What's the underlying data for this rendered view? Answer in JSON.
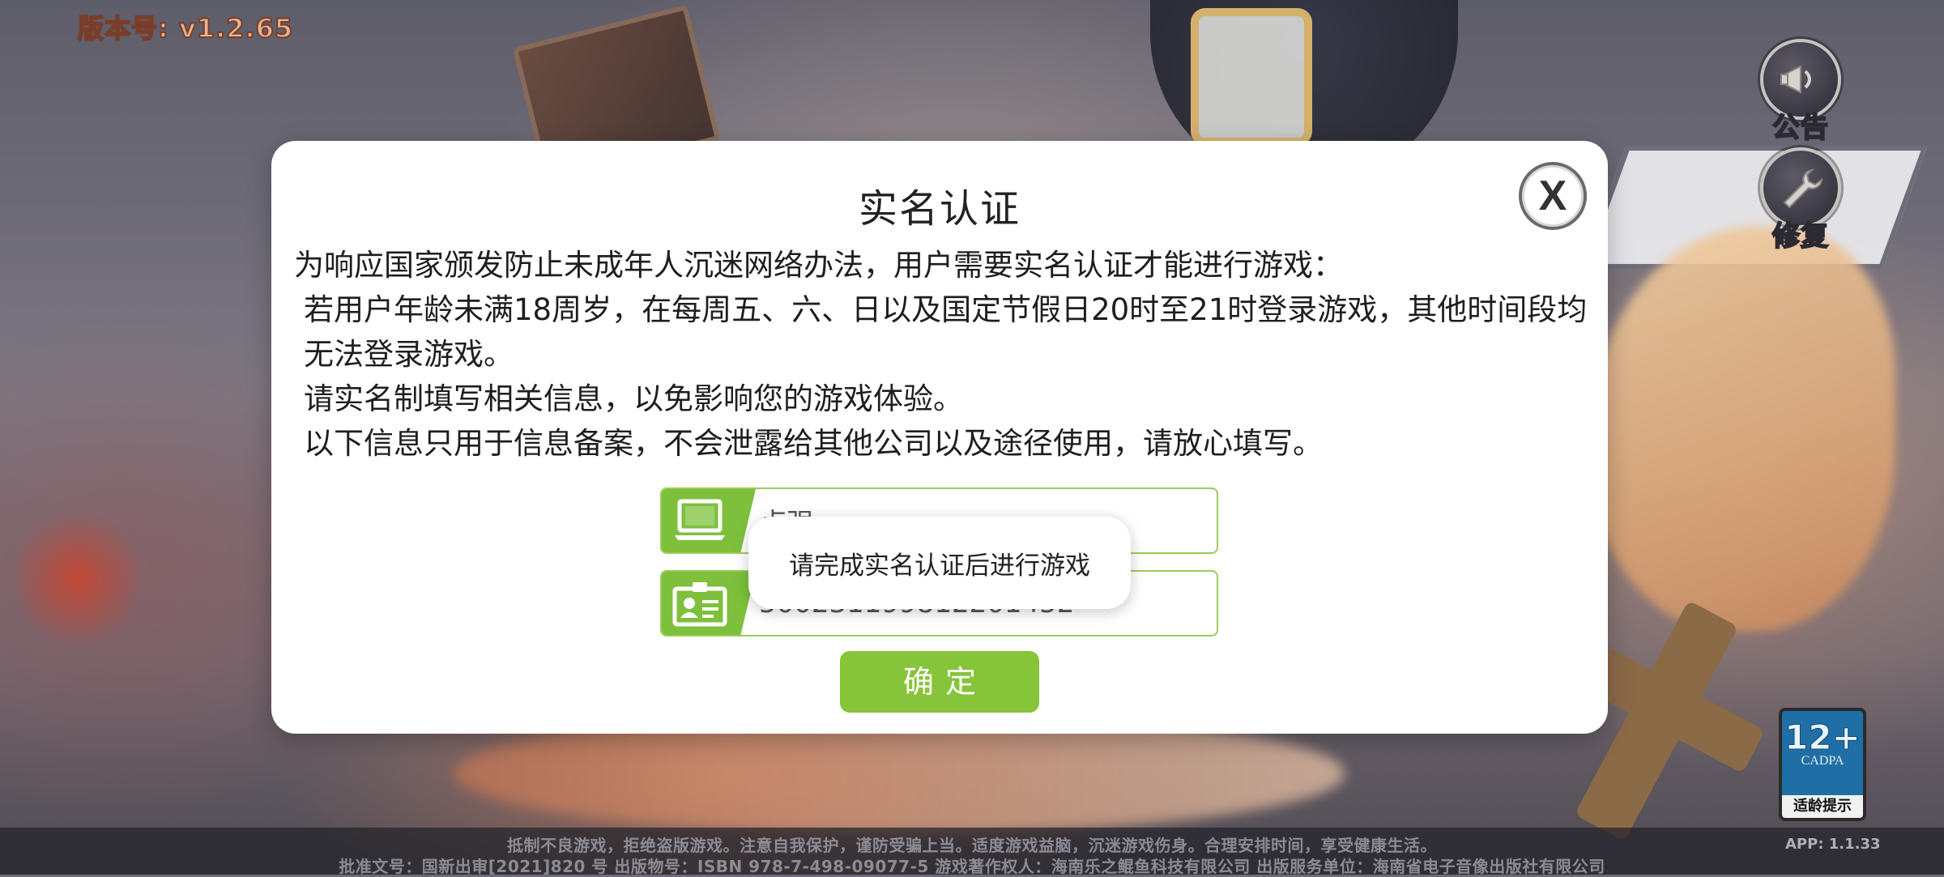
{
  "game": {
    "version_label": "版本号: v1.2.65"
  },
  "side_buttons": {
    "notice_label": "公告",
    "repair_label": "修复"
  },
  "age_badge": {
    "age": "12+",
    "org": "CADPA",
    "tip": "适龄提示"
  },
  "footer": {
    "line1": "抵制不良游戏，拒绝盗版游戏。注意自我保护，谨防受骗上当。适度游戏益脑，沉迷游戏伤身。合理安排时间，享受健康生活。",
    "line2": "批准文号：国新出审[2021]820 号 出版物号：ISBN 978-7-498-09077-5 游戏著作权人：海南乐之鲲鱼科技有限公司 出版服务单位：海南省电子音像出版社有限公司",
    "app_version": "APP: 1.1.33"
  },
  "dialog": {
    "title": "实名认证",
    "close_label": "X",
    "paragraphs": [
      "为响应国家颁发防止未成年人沉迷网络办法，用户需要实名认证才能进行游戏：",
      "若用户年龄未满18周岁，在每周五、六、日以及国定节假日20时至21时登录游戏，其他时间段均无法登录游戏。",
      "请实名制填写相关信息，以免影响您的游戏体验。",
      "以下信息只用于信息备案，不会泄露给其他公司以及途径使用，请放心填写。"
    ],
    "name_value": "卢强",
    "id_value": "500231199812201452",
    "confirm_label": "确定"
  },
  "toast": {
    "message": "请完成实名认证后进行游戏"
  },
  "colors": {
    "accent_green": "#86c43a",
    "field_border": "#9ccc5a",
    "version_text": "#e6b48f"
  },
  "icons": {
    "notice": "megaphone-icon",
    "repair": "wrench-icon",
    "name_field": "computer-icon",
    "id_field": "id-card-icon",
    "close": "close-icon"
  }
}
